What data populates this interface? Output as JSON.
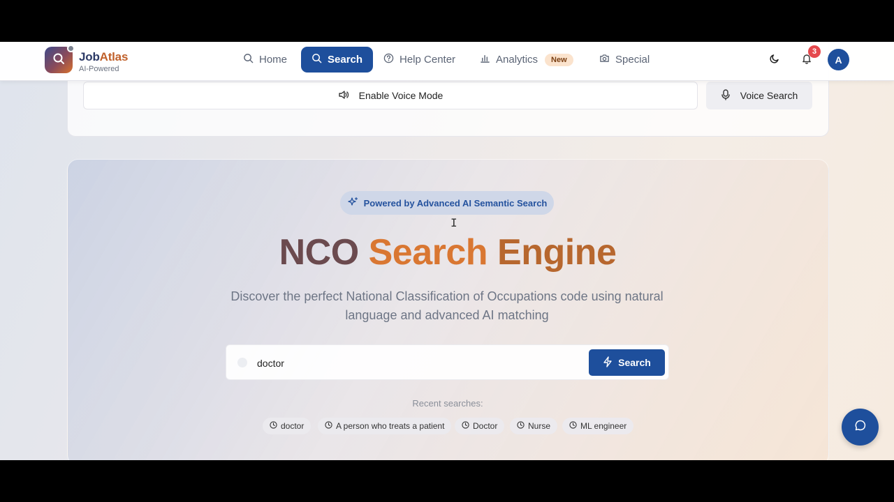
{
  "brand": {
    "name_part1": "Job",
    "name_part2": "Atlas",
    "subtitle": "AI-Powered"
  },
  "nav": {
    "home": "Home",
    "search": "Search",
    "help": "Help Center",
    "analytics": "Analytics",
    "analytics_badge": "New",
    "special": "Special"
  },
  "header": {
    "notification_count": "3",
    "avatar_initial": "A"
  },
  "voice": {
    "enable_label": "Enable Voice Mode",
    "search_label": "Voice Search"
  },
  "hero": {
    "pill": "Powered by Advanced AI Semantic Search",
    "title_part1": "NCO ",
    "title_part2": "Search ",
    "title_part3": "Engine",
    "description": "Discover the perfect National Classification of Occupations code using natural language and advanced AI matching"
  },
  "search": {
    "value": "doctor",
    "button_label": "Search"
  },
  "recent": {
    "label": "Recent searches:",
    "items": [
      "doctor",
      "A person who treats a patient",
      "Doctor",
      "Nurse",
      "ML engineer"
    ]
  },
  "colors": {
    "primary": "#1e4f9c",
    "accent": "#d97732",
    "badge_red": "#e5484d"
  }
}
